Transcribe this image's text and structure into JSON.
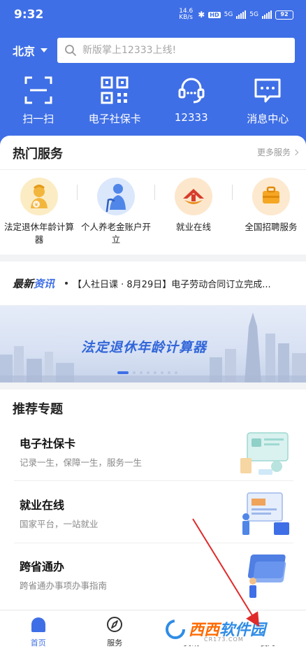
{
  "status_bar": {
    "time": "9:32",
    "net_speed": "14.6 KB/s",
    "hd": "HD",
    "sig1": "5G",
    "sig2": "5G",
    "battery": "92"
  },
  "header": {
    "city": "北京",
    "search_placeholder": "新版掌上12333上线!"
  },
  "quick_actions": [
    {
      "label": "扫一扫",
      "icon": "scan-icon"
    },
    {
      "label": "电子社保卡",
      "icon": "qr-code-icon"
    },
    {
      "label": "12333",
      "icon": "headset-icon"
    },
    {
      "label": "消息中心",
      "icon": "message-icon"
    }
  ],
  "hot_services": {
    "title": "热门服务",
    "more": "更多服务",
    "items": [
      {
        "label": "法定退休年龄计算器",
        "icon": "retirement-calculator-icon"
      },
      {
        "label": "个人养老金账户开立",
        "icon": "pension-account-icon"
      },
      {
        "label": "就业在线",
        "icon": "employment-icon"
      },
      {
        "label": "全国招聘服务",
        "icon": "recruitment-icon"
      }
    ]
  },
  "news": {
    "tag_a": "最新",
    "tag_b": "资讯",
    "text": "【人社日课 · 8月29日】电子劳动合同订立完成..."
  },
  "banner": {
    "title": "法定退休年龄计算器",
    "dot_count": 8,
    "active_dot": 0
  },
  "recommend": {
    "title": "推荐专题",
    "items": [
      {
        "title": "电子社保卡",
        "subtitle": "记录一生，保障一生，服务一生"
      },
      {
        "title": "就业在线",
        "subtitle": "国家平台，一站就业"
      },
      {
        "title": "跨省通办",
        "subtitle": "跨省通办事项办事指南"
      }
    ]
  },
  "bottom_nav": [
    {
      "label": "首页",
      "active": true
    },
    {
      "label": "服务",
      "active": false
    },
    {
      "label": "资讯",
      "active": false
    },
    {
      "label": "我的",
      "active": false
    }
  ],
  "watermark": {
    "brand_a": "西西",
    "brand_b": "软件园",
    "url": "CR173.COM"
  },
  "colors": {
    "brand_blue": "#3f6fe6",
    "annotation_red": "#e02a2a"
  }
}
